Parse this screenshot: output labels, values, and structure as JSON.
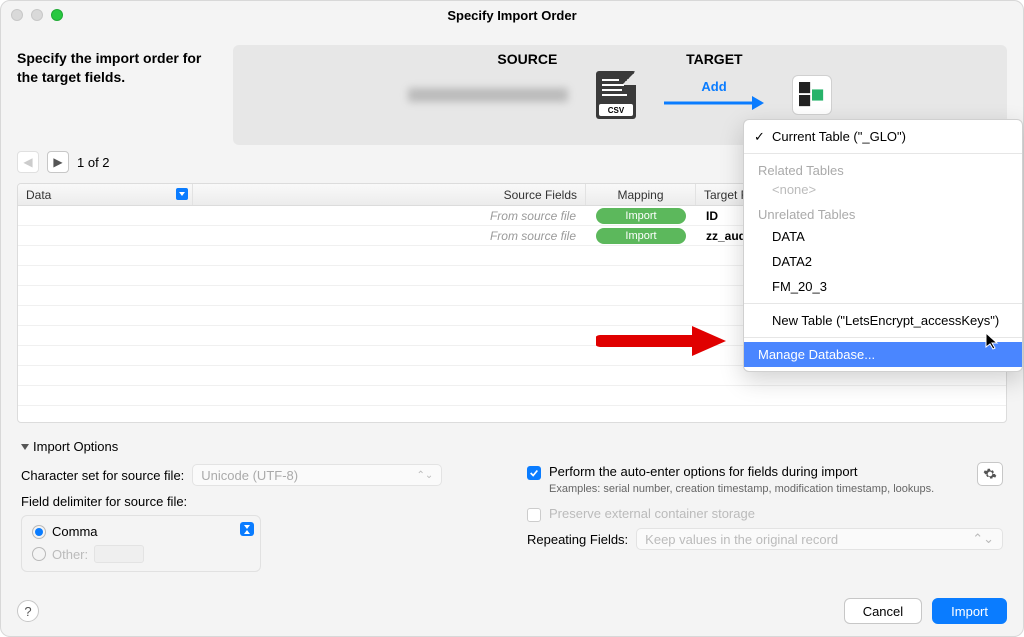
{
  "window": {
    "title": "Specify Import Order"
  },
  "instructions": "Specify the import order for the target fields.",
  "banner": {
    "source_label": "SOURCE",
    "target_label": "TARGET",
    "add_label": "Add",
    "csv_badge": "CSV"
  },
  "pager": {
    "text": "1 of 2"
  },
  "grid": {
    "headers": {
      "first": "Data",
      "source_fields": "Source Fields",
      "mapping": "Mapping",
      "target_fields": "Target F"
    },
    "rows": [
      {
        "source": "From source file",
        "mapping": "Import",
        "target": "ID"
      },
      {
        "source": "From source file",
        "mapping": "Import",
        "target": "zz_audi"
      }
    ]
  },
  "popover": {
    "current_table": "Current Table (\"_GLO\")",
    "related_header": "Related Tables",
    "related_none": "<none>",
    "unrelated_header": "Unrelated Tables",
    "unrelated": [
      "DATA",
      "DATA2",
      "FM_20_3"
    ],
    "new_table": "New Table (\"LetsEncrypt_accessKeys\")",
    "manage_db": "Manage Database..."
  },
  "options": {
    "title": "Import Options",
    "charset_label": "Character set for source file:",
    "charset_value": "Unicode (UTF-8)",
    "delimiter_label": "Field delimiter for source file:",
    "delimiter_comma": "Comma",
    "delimiter_other": "Other:",
    "auto_enter_label": "Perform the auto-enter options for fields during import",
    "auto_enter_examples": "Examples: serial number, creation timestamp, modification timestamp, lookups.",
    "preserve_label": "Preserve external container storage",
    "repeating_label": "Repeating Fields:",
    "repeating_value": "Keep values in the original record"
  },
  "buttons": {
    "cancel": "Cancel",
    "import": "Import"
  }
}
